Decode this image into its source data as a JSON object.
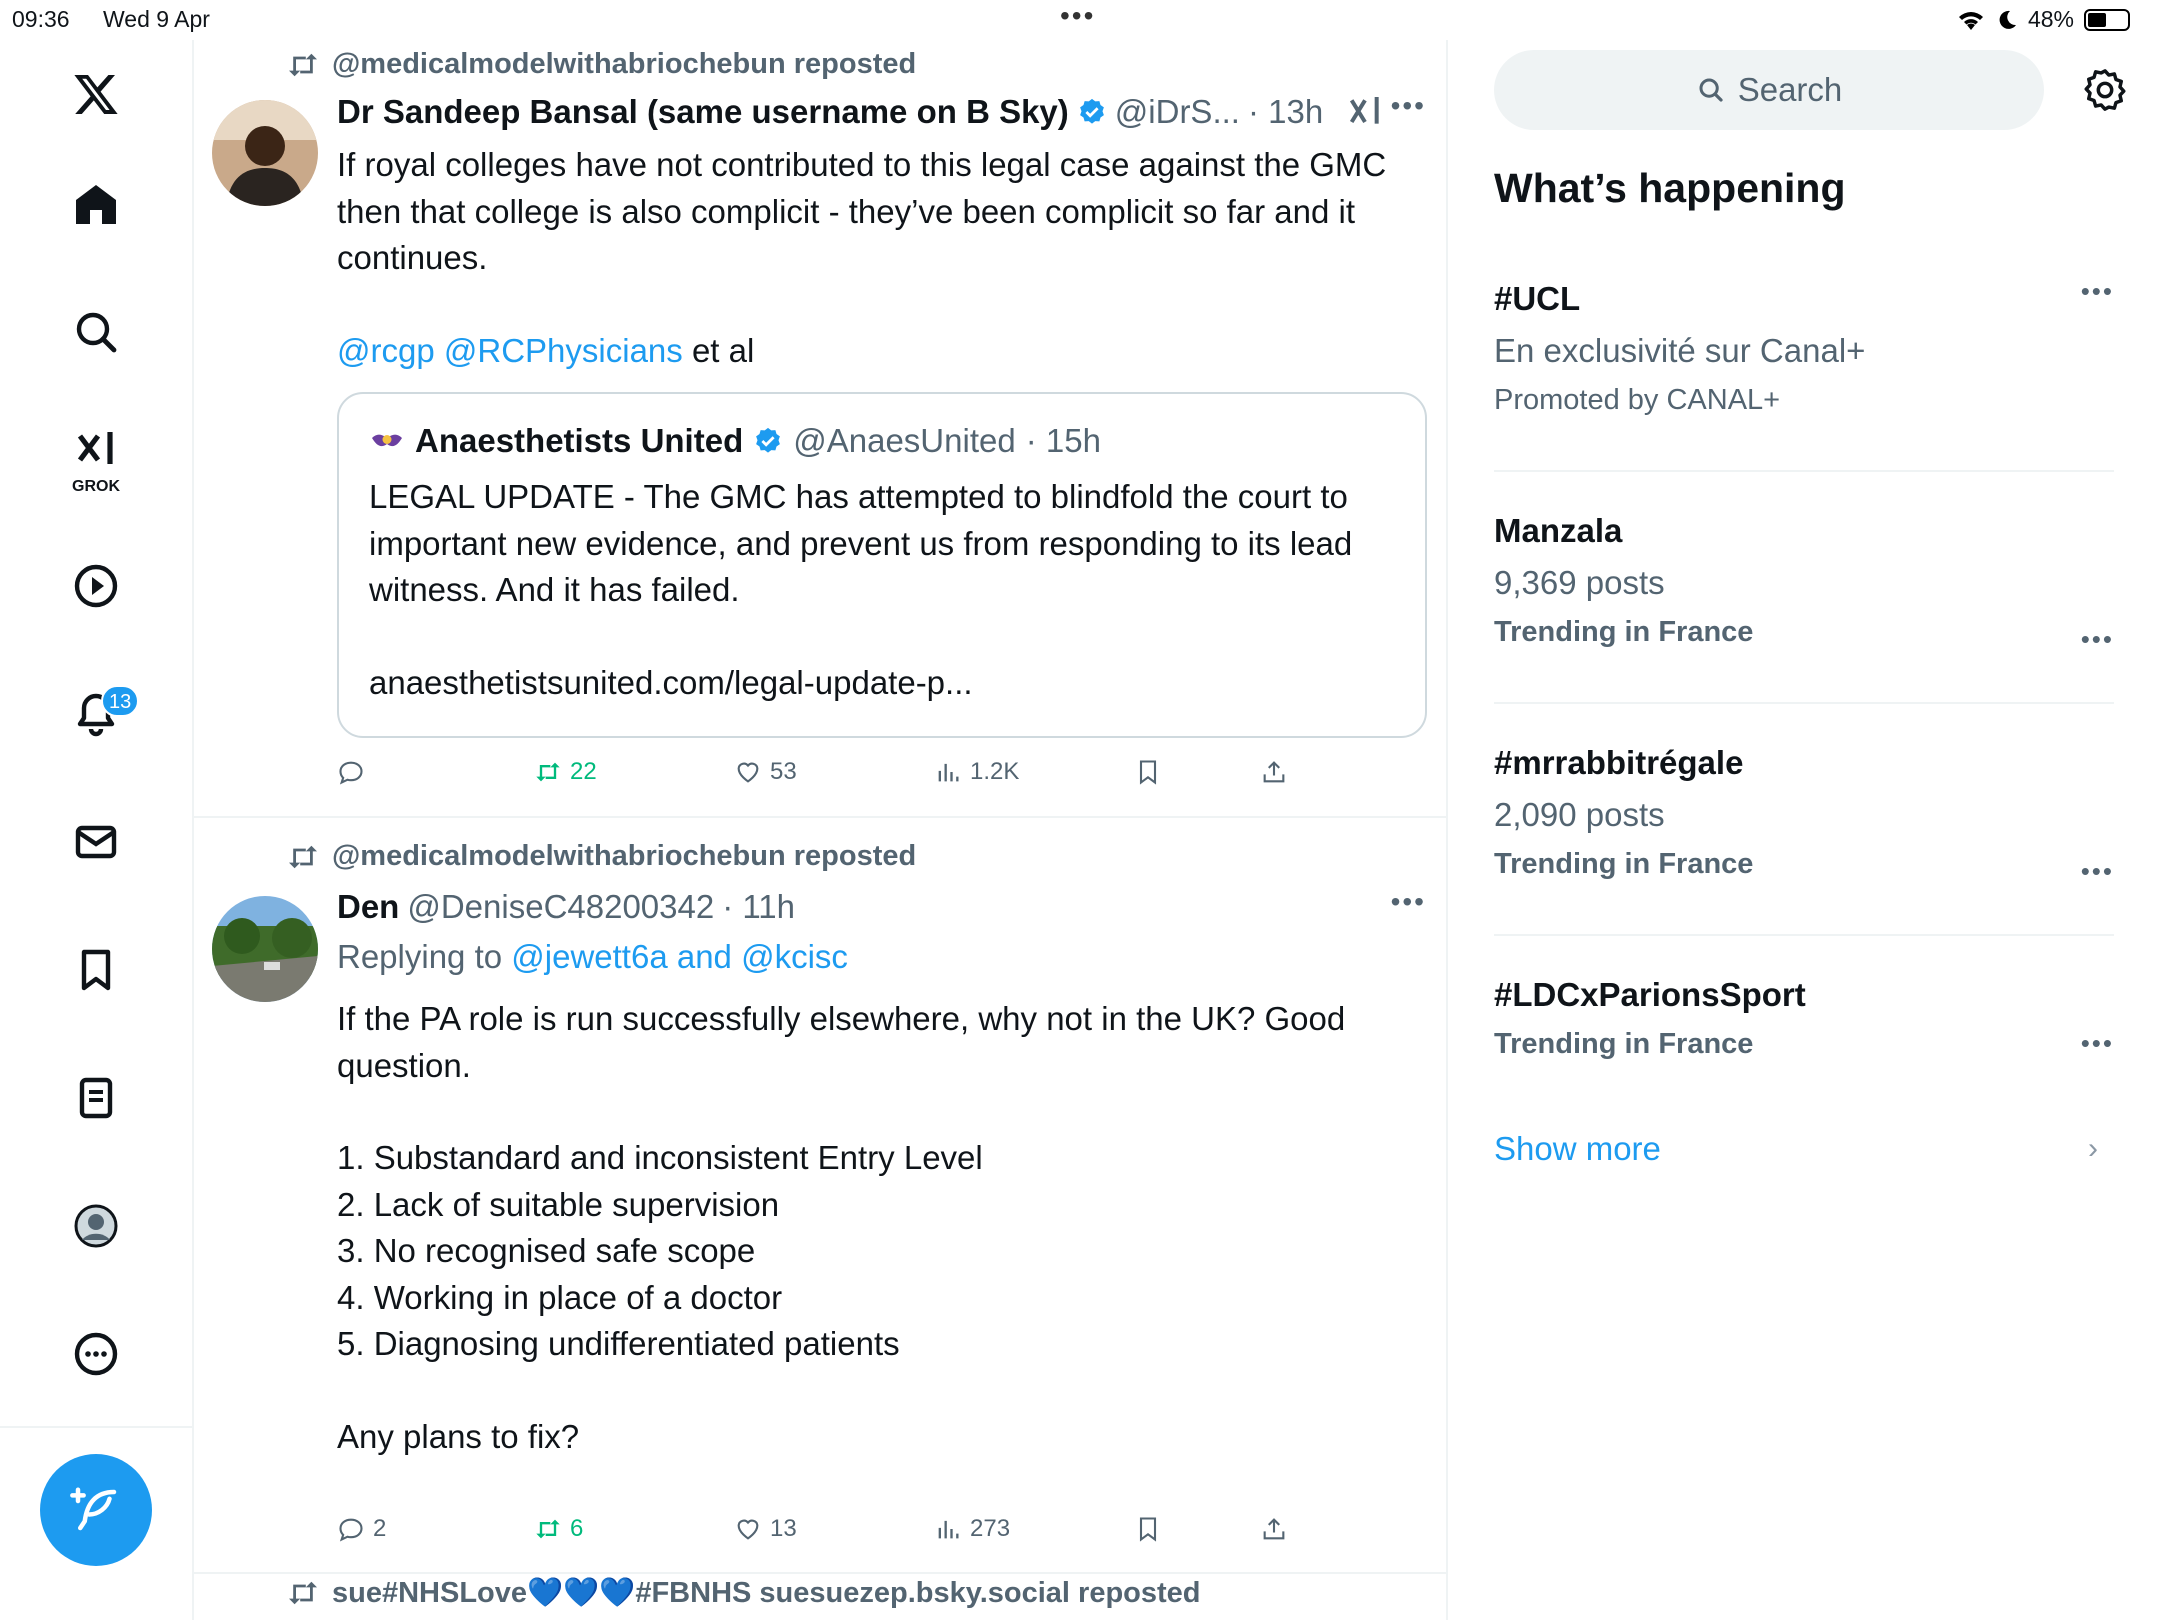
{
  "status": {
    "time": "09:36",
    "date": "Wed 9 Apr",
    "battery": "48%",
    "battery_level": 0.48
  },
  "sidebar": {
    "grok_label": "GROK",
    "notification_count": "13"
  },
  "tweets": [
    {
      "reposter": "@medicalmodelwithabriochebun reposted",
      "name": "Dr Sandeep Bansal (same username on B Sky)",
      "handle": "@iDrS...",
      "time": "· 13h",
      "text_lines": [
        "If royal colleges have not contributed to this legal case against the GMC",
        "then that college is also complicit - they’ve been complicit so far and it",
        "continues."
      ],
      "mention1": "@rcgp",
      "mention2": "@RCPhysicians",
      "mention_suffix": " et al",
      "quote": {
        "name": "Anaesthetists United",
        "handle": "@AnaesUnited",
        "time": "· 15h",
        "text_lines": [
          "LEGAL UPDATE - The GMC has attempted to blindfold the court to",
          "important new evidence, and prevent us from responding to its lead",
          "witness. And it has failed."
        ],
        "link": "anaesthetistsunited.com/legal-update-p..."
      },
      "reposts": "22",
      "likes": "53",
      "views": "1.2K"
    },
    {
      "reposter": "@medicalmodelwithabriochebun reposted",
      "name": "Den",
      "handle": "@DeniseC48200342",
      "time": "· 11h",
      "replying_prefix": "Replying to ",
      "replying_users": "@jewett6a and @kcisc",
      "text_lines": [
        "If the PA role is run successfully elsewhere, why not in the UK? Good",
        "question."
      ],
      "list": [
        "1. Substandard and inconsistent Entry Level",
        "2. Lack of suitable supervision",
        "3. No recognised safe scope",
        "4. Working in place of a doctor",
        "5. Diagnosing undifferentiated patients"
      ],
      "closing": "Any plans to fix?",
      "replies": "2",
      "reposts": "6",
      "likes": "13",
      "views": "273"
    },
    {
      "reposter": "sue#NHSLove💙💙💙#FBNHS suesuezep.bsky.social reposted"
    }
  ],
  "right": {
    "search_placeholder": "Search",
    "section_title": "What’s happening",
    "trends": [
      {
        "name": "#UCL",
        "sub": "En exclusivité sur Canal+",
        "meta": "Promoted by CANAL+"
      },
      {
        "name": "Manzala",
        "sub": "9,369 posts",
        "meta": "Trending in France"
      },
      {
        "name": "#mrrabbitrégale",
        "sub": "2,090 posts",
        "meta": "Trending in France"
      },
      {
        "name": "#LDCxParionsSport",
        "meta": "Trending in France"
      }
    ],
    "show_more": "Show more"
  },
  "colors": {
    "accent": "#1d9bf0",
    "repost_green": "#00ba7c",
    "secondary_text": "#536471"
  }
}
